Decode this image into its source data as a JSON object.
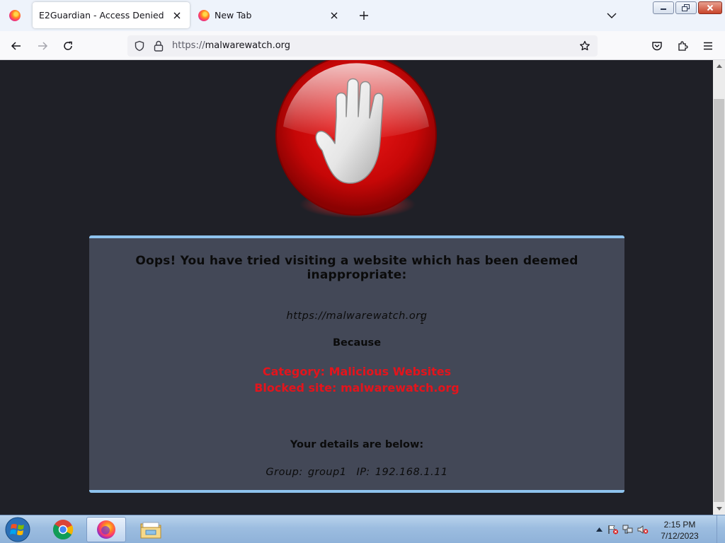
{
  "window": {
    "tabs": [
      {
        "title": "E2Guardian - Access Denied",
        "active": true
      },
      {
        "title": "New Tab",
        "active": false
      }
    ],
    "controls": [
      "minimize-icon",
      "restore-icon",
      "close-icon"
    ]
  },
  "navbar": {
    "url_scheme": "https://",
    "url_host": "malwarewatch.org"
  },
  "page": {
    "heading": "Oops! You have tried visiting a website which has been deemed inappropriate:",
    "blocked_url": "https://malwarewatch.org",
    "because_label": "Because",
    "category": "Category: Malicious Websites",
    "blocked_site": "Blocked site: malwarewatch.org",
    "details_heading": "Your details are below:",
    "group_text": "Group: group1",
    "ip_text": "IP: 192.168.1.11"
  },
  "colors": {
    "page_background": "#1f2027",
    "box_background": "#434857",
    "box_border": "#8ec3ee",
    "alert_red": "#e4141c"
  },
  "taskbar": {
    "apps": [
      "chrome-icon",
      "firefox-icon",
      "file-explorer-icon"
    ],
    "active_app": "firefox-icon",
    "clock_time": "2:15 PM",
    "clock_date": "7/12/2023"
  }
}
